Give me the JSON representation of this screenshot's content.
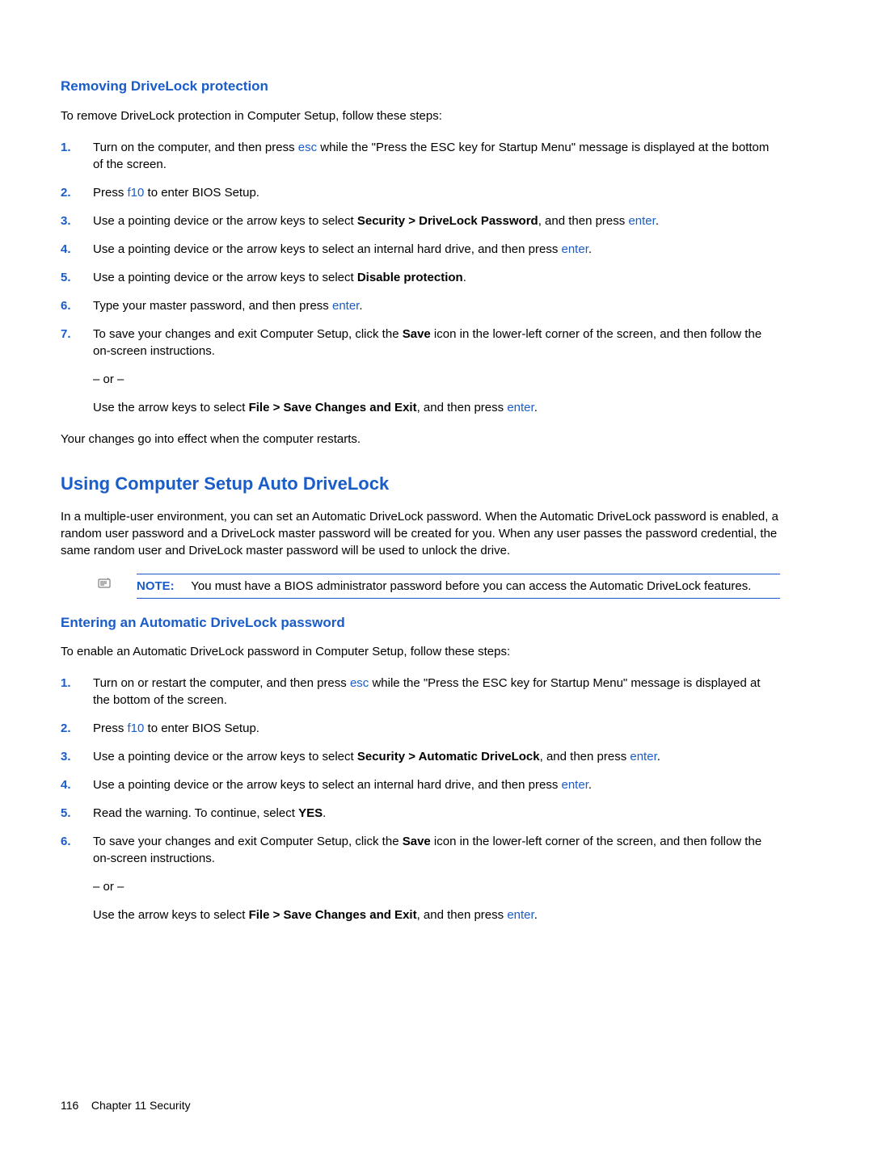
{
  "section1": {
    "heading": "Removing DriveLock protection",
    "intro": "To remove DriveLock protection in Computer Setup, follow these steps:",
    "steps": {
      "s1_a": "Turn on the computer, and then press ",
      "s1_key": "esc",
      "s1_b": " while the \"Press the ESC key for Startup Menu\" message is displayed at the bottom of the screen.",
      "s2_a": "Press ",
      "s2_key": "f10",
      "s2_b": " to enter BIOS Setup.",
      "s3_a": "Use a pointing device or the arrow keys to select ",
      "s3_bold": "Security > DriveLock Password",
      "s3_b": ", and then press ",
      "s3_key": "enter",
      "s3_c": ".",
      "s4_a": "Use a pointing device or the arrow keys to select an internal hard drive, and then press ",
      "s4_key": "enter",
      "s4_b": ".",
      "s5_a": "Use a pointing device or the arrow keys to select ",
      "s5_bold": "Disable protection",
      "s5_b": ".",
      "s6_a": "Type your master password, and then press ",
      "s6_key": "enter",
      "s6_b": ".",
      "s7_a": "To save your changes and exit Computer Setup, click the ",
      "s7_bold": "Save",
      "s7_b": " icon in the lower-left corner of the screen, and then follow the on-screen instructions.",
      "s7_or": "– or –",
      "s7_c": "Use the arrow keys to select ",
      "s7_bold2": "File > Save Changes and Exit",
      "s7_d": ", and then press ",
      "s7_key": "enter",
      "s7_e": "."
    },
    "closing": "Your changes go into effect when the computer restarts."
  },
  "section2": {
    "heading": "Using Computer Setup Auto DriveLock",
    "intro": "In a multiple-user environment, you can set an Automatic DriveLock password. When the Automatic DriveLock password is enabled, a random user password and a DriveLock master password will be created for you. When any user passes the password credential, the same random user and DriveLock master password will be used to unlock the drive.",
    "note_label": "NOTE:",
    "note_text": "You must have a BIOS administrator password before you can access the Automatic DriveLock features."
  },
  "section3": {
    "heading": "Entering an Automatic DriveLock password",
    "intro": "To enable an Automatic DriveLock password in Computer Setup, follow these steps:",
    "steps": {
      "s1_a": "Turn on or restart the computer, and then press ",
      "s1_key": "esc",
      "s1_b": " while the \"Press the ESC key for Startup Menu\" message is displayed at the bottom of the screen.",
      "s2_a": "Press ",
      "s2_key": "f10",
      "s2_b": " to enter BIOS Setup.",
      "s3_a": "Use a pointing device or the arrow keys to select ",
      "s3_bold": "Security > Automatic DriveLock",
      "s3_b": ", and then press ",
      "s3_key": "enter",
      "s3_c": ".",
      "s4_a": "Use a pointing device or the arrow keys to select an internal hard drive, and then press ",
      "s4_key": "enter",
      "s4_b": ".",
      "s5_a": "Read the warning. To continue, select ",
      "s5_bold": "YES",
      "s5_b": ".",
      "s6_a": "To save your changes and exit Computer Setup, click the ",
      "s6_bold": "Save",
      "s6_b": " icon in the lower-left corner of the screen, and then follow the on-screen instructions.",
      "s6_or": "– or –",
      "s6_c": "Use the arrow keys to select ",
      "s6_bold2": "File > Save Changes and Exit",
      "s6_d": ", and then press ",
      "s6_key": "enter",
      "s6_e": "."
    }
  },
  "footer": {
    "page_num": "116",
    "chapter": "Chapter 11   Security"
  },
  "nums": {
    "n1": "1.",
    "n2": "2.",
    "n3": "3.",
    "n4": "4.",
    "n5": "5.",
    "n6": "6.",
    "n7": "7."
  }
}
